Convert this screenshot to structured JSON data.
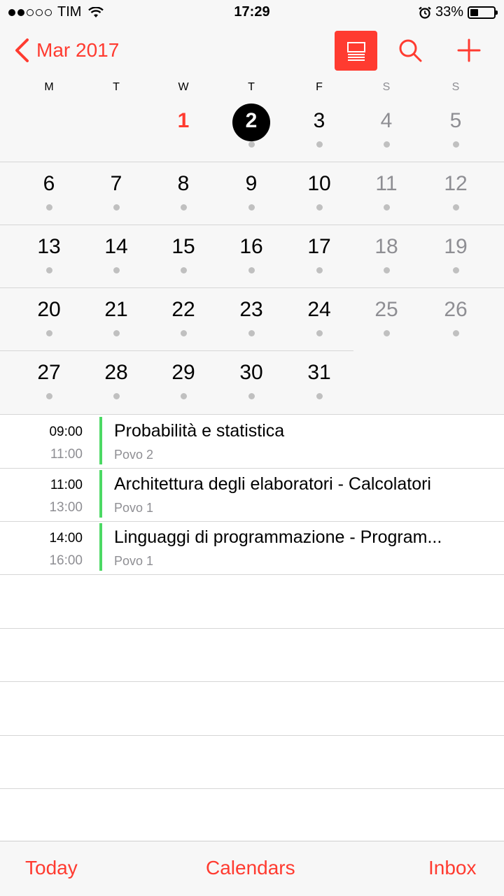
{
  "status_bar": {
    "carrier": "TIM",
    "time": "17:29",
    "battery": "33%",
    "battery_level": 0.33,
    "signal_bars_filled": 2,
    "signal_bars_total": 5
  },
  "nav": {
    "back_label": "Mar 2017",
    "accent_color": "#ff3b30",
    "icons": [
      "chevron-left-icon",
      "list-view-icon",
      "search-icon",
      "plus-icon"
    ]
  },
  "weekdays": [
    "M",
    "T",
    "W",
    "T",
    "F",
    "S",
    "S"
  ],
  "month": {
    "weeks": [
      [
        "",
        "",
        "1",
        "2",
        "3",
        "4",
        "5"
      ],
      [
        "6",
        "7",
        "8",
        "9",
        "10",
        "11",
        "12"
      ],
      [
        "13",
        "14",
        "15",
        "16",
        "17",
        "18",
        "19"
      ],
      [
        "20",
        "21",
        "22",
        "23",
        "24",
        "25",
        "26"
      ],
      [
        "27",
        "28",
        "29",
        "30",
        "31",
        "",
        ""
      ]
    ],
    "today": "1",
    "selected": "2",
    "days_with_events": [
      "2",
      "3",
      "4",
      "5",
      "6",
      "7",
      "8",
      "9",
      "10",
      "11",
      "12",
      "13",
      "14",
      "15",
      "16",
      "17",
      "18",
      "19",
      "20",
      "21",
      "22",
      "23",
      "24",
      "25",
      "26",
      "27",
      "28",
      "29",
      "30",
      "31"
    ]
  },
  "events": [
    {
      "start": "09:00",
      "end": "11:00",
      "title": "Probabilità e statistica",
      "location": "Povo 2",
      "calendar_color": "#4cd964"
    },
    {
      "start": "11:00",
      "end": "13:00",
      "title": "Architettura degli elaboratori - Calcolatori",
      "location": "Povo 1",
      "calendar_color": "#4cd964"
    },
    {
      "start": "14:00",
      "end": "16:00",
      "title": "Linguaggi di programmazione - Program...",
      "location": "Povo 1",
      "calendar_color": "#4cd964"
    }
  ],
  "tab_bar": {
    "today": "Today",
    "calendars": "Calendars",
    "inbox": "Inbox"
  }
}
